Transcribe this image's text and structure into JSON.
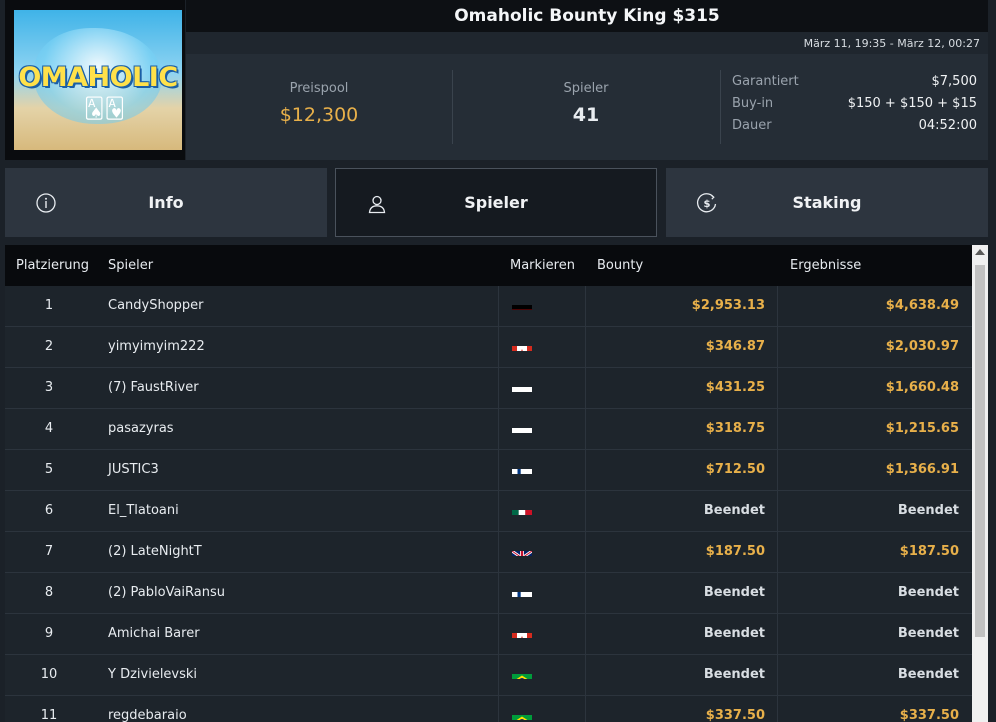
{
  "logo": {
    "text": "OMAHOLIC"
  },
  "header": {
    "title": "Omaholic Bounty King $315",
    "date_range": "März 11, 19:35 - März 12, 00:27"
  },
  "stats": {
    "prizepool_label": "Preispool",
    "prizepool_value": "$12,300",
    "players_label": "Spieler",
    "players_value": "41",
    "details": [
      {
        "key": "Garantiert",
        "value": "$7,500"
      },
      {
        "key": "Buy-in",
        "value": "$150 + $150 + $15"
      },
      {
        "key": "Dauer",
        "value": "04:52:00"
      }
    ]
  },
  "tabs": {
    "info": {
      "label": "Info",
      "icon": "info-icon"
    },
    "players": {
      "label": "Spieler",
      "icon": "user-icon",
      "active": true
    },
    "staking": {
      "label": "Staking",
      "icon": "dollar-icon"
    }
  },
  "table": {
    "headers": {
      "place": "Platzierung",
      "player": "Spieler",
      "flag": "Markieren",
      "bounty": "Bounty",
      "results": "Ergebnisse"
    },
    "rows": [
      {
        "place": "1",
        "player": "CandyShopper",
        "flag": "de",
        "bounty": "$2,953.13",
        "result": "$4,638.49"
      },
      {
        "place": "2",
        "player": "yimyimyim222",
        "flag": "ca",
        "bounty": "$346.87",
        "result": "$2,030.97"
      },
      {
        "place": "3",
        "player": "(7) FaustRiver",
        "flag": "pl",
        "bounty": "$431.25",
        "result": "$1,660.48"
      },
      {
        "place": "4",
        "player": "pasazyras",
        "flag": "pl",
        "bounty": "$318.75",
        "result": "$1,215.65"
      },
      {
        "place": "5",
        "player": "JUSTIC3",
        "flag": "fi",
        "bounty": "$712.50",
        "result": "$1,366.91"
      },
      {
        "place": "6",
        "player": "El_Tlatoani",
        "flag": "mx",
        "bounty": "Beendet",
        "result": "Beendet"
      },
      {
        "place": "7",
        "player": "(2) LateNightT",
        "flag": "gb",
        "bounty": "$187.50",
        "result": "$187.50"
      },
      {
        "place": "8",
        "player": "(2) PabloVaiRansu",
        "flag": "fi",
        "bounty": "Beendet",
        "result": "Beendet"
      },
      {
        "place": "9",
        "player": "Amichai Barer",
        "flag": "ca",
        "bounty": "Beendet",
        "result": "Beendet"
      },
      {
        "place": "10",
        "player": "Y Dzivielevski",
        "flag": "br",
        "bounty": "Beendet",
        "result": "Beendet"
      },
      {
        "place": "11",
        "player": "regdebaraio",
        "flag": "br",
        "bounty": "$337.50",
        "result": "$337.50"
      }
    ]
  },
  "colors": {
    "accent_gold": "#e8b04a",
    "background": "#1b2128"
  }
}
